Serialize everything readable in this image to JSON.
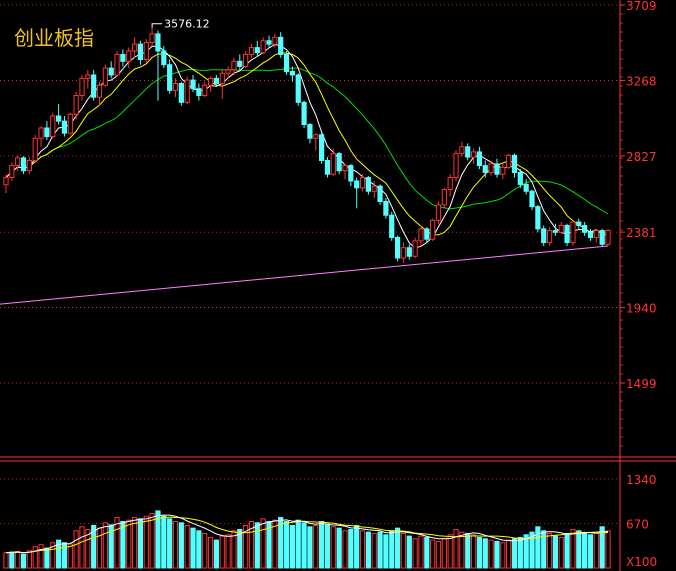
{
  "title": "创业板指",
  "chart_data": {
    "type": "candlestick",
    "title": "创业板指",
    "price_axis": {
      "ticks": [
        3709,
        3268,
        2827,
        2381,
        1940,
        1499
      ]
    },
    "volume_axis": {
      "ticks": [
        1340,
        670
      ],
      "unit": "X100"
    },
    "annotations": {
      "high_label": "3576.12",
      "high_value": 3576.12,
      "high_index": 25
    },
    "colors": {
      "up": "#ff3232",
      "down": "#54ffff",
      "ma5": "#ffffff",
      "ma10": "#ffff00",
      "ma20": "#00dd00",
      "ma250": "#ff80ff",
      "axis": "#ff3232",
      "label": "#ff3232"
    },
    "candles": [
      {
        "o": 2658,
        "h": 2720,
        "l": 2610,
        "c": 2700
      },
      {
        "o": 2700,
        "h": 2790,
        "l": 2680,
        "c": 2770
      },
      {
        "o": 2770,
        "h": 2830,
        "l": 2740,
        "c": 2815
      },
      {
        "o": 2815,
        "h": 2825,
        "l": 2720,
        "c": 2740
      },
      {
        "o": 2740,
        "h": 2820,
        "l": 2720,
        "c": 2800
      },
      {
        "o": 2800,
        "h": 2950,
        "l": 2790,
        "c": 2930
      },
      {
        "o": 2930,
        "h": 3000,
        "l": 2880,
        "c": 2990
      },
      {
        "o": 2990,
        "h": 3030,
        "l": 2920,
        "c": 2940
      },
      {
        "o": 2940,
        "h": 3080,
        "l": 2930,
        "c": 3060
      },
      {
        "o": 3060,
        "h": 3130,
        "l": 3010,
        "c": 3030
      },
      {
        "o": 3030,
        "h": 3060,
        "l": 2940,
        "c": 2960
      },
      {
        "o": 2960,
        "h": 3080,
        "l": 2950,
        "c": 3070
      },
      {
        "o": 3070,
        "h": 3200,
        "l": 3040,
        "c": 3180
      },
      {
        "o": 3180,
        "h": 3300,
        "l": 3150,
        "c": 3280
      },
      {
        "o": 3280,
        "h": 3330,
        "l": 3220,
        "c": 3300
      },
      {
        "o": 3300,
        "h": 3330,
        "l": 3150,
        "c": 3170
      },
      {
        "o": 3170,
        "h": 3260,
        "l": 3120,
        "c": 3240
      },
      {
        "o": 3240,
        "h": 3360,
        "l": 3230,
        "c": 3340
      },
      {
        "o": 3340,
        "h": 3380,
        "l": 3280,
        "c": 3300
      },
      {
        "o": 3300,
        "h": 3440,
        "l": 3290,
        "c": 3420
      },
      {
        "o": 3420,
        "h": 3450,
        "l": 3350,
        "c": 3380
      },
      {
        "o": 3380,
        "h": 3460,
        "l": 3340,
        "c": 3440
      },
      {
        "o": 3440,
        "h": 3520,
        "l": 3400,
        "c": 3480
      },
      {
        "o": 3480,
        "h": 3500,
        "l": 3360,
        "c": 3390
      },
      {
        "o": 3390,
        "h": 3510,
        "l": 3370,
        "c": 3490
      },
      {
        "o": 3490,
        "h": 3576,
        "l": 3470,
        "c": 3540
      },
      {
        "o": 3540,
        "h": 3560,
        "l": 3150,
        "c": 3440
      },
      {
        "o": 3440,
        "h": 3470,
        "l": 3340,
        "c": 3360
      },
      {
        "o": 3360,
        "h": 3390,
        "l": 3190,
        "c": 3210
      },
      {
        "o": 3210,
        "h": 3280,
        "l": 3170,
        "c": 3250
      },
      {
        "o": 3250,
        "h": 3260,
        "l": 3120,
        "c": 3140
      },
      {
        "o": 3140,
        "h": 3290,
        "l": 3130,
        "c": 3270
      },
      {
        "o": 3270,
        "h": 3300,
        "l": 3200,
        "c": 3220
      },
      {
        "o": 3220,
        "h": 3250,
        "l": 3150,
        "c": 3180
      },
      {
        "o": 3180,
        "h": 3260,
        "l": 3170,
        "c": 3240
      },
      {
        "o": 3240,
        "h": 3290,
        "l": 3200,
        "c": 3280
      },
      {
        "o": 3280,
        "h": 3300,
        "l": 3230,
        "c": 3250
      },
      {
        "o": 3250,
        "h": 3330,
        "l": 3160,
        "c": 3310
      },
      {
        "o": 3310,
        "h": 3350,
        "l": 3280,
        "c": 3330
      },
      {
        "o": 3330,
        "h": 3400,
        "l": 3300,
        "c": 3380
      },
      {
        "o": 3380,
        "h": 3420,
        "l": 3330,
        "c": 3350
      },
      {
        "o": 3350,
        "h": 3440,
        "l": 3340,
        "c": 3420
      },
      {
        "o": 3420,
        "h": 3480,
        "l": 3400,
        "c": 3460
      },
      {
        "o": 3460,
        "h": 3500,
        "l": 3410,
        "c": 3430
      },
      {
        "o": 3430,
        "h": 3520,
        "l": 3420,
        "c": 3500
      },
      {
        "o": 3500,
        "h": 3530,
        "l": 3460,
        "c": 3480
      },
      {
        "o": 3480,
        "h": 3540,
        "l": 3460,
        "c": 3520
      },
      {
        "o": 3520,
        "h": 3550,
        "l": 3400,
        "c": 3420
      },
      {
        "o": 3420,
        "h": 3440,
        "l": 3300,
        "c": 3320
      },
      {
        "o": 3320,
        "h": 3350,
        "l": 3260,
        "c": 3300
      },
      {
        "o": 3300,
        "h": 3310,
        "l": 3120,
        "c": 3140
      },
      {
        "o": 3140,
        "h": 3150,
        "l": 2990,
        "c": 3010
      },
      {
        "o": 3010,
        "h": 3020,
        "l": 2900,
        "c": 2930
      },
      {
        "o": 2930,
        "h": 2960,
        "l": 2860,
        "c": 2950
      },
      {
        "o": 2950,
        "h": 2960,
        "l": 2780,
        "c": 2800
      },
      {
        "o": 2800,
        "h": 2820,
        "l": 2700,
        "c": 2720
      },
      {
        "o": 2720,
        "h": 2870,
        "l": 2710,
        "c": 2840
      },
      {
        "o": 2840,
        "h": 2850,
        "l": 2720,
        "c": 2740
      },
      {
        "o": 2740,
        "h": 2780,
        "l": 2690,
        "c": 2770
      },
      {
        "o": 2770,
        "h": 2780,
        "l": 2650,
        "c": 2680
      },
      {
        "o": 2680,
        "h": 2700,
        "l": 2520,
        "c": 2640
      },
      {
        "o": 2640,
        "h": 2720,
        "l": 2620,
        "c": 2700
      },
      {
        "o": 2700,
        "h": 2710,
        "l": 2600,
        "c": 2620
      },
      {
        "o": 2620,
        "h": 2680,
        "l": 2580,
        "c": 2650
      },
      {
        "o": 2650,
        "h": 2660,
        "l": 2540,
        "c": 2560
      },
      {
        "o": 2560,
        "h": 2580,
        "l": 2460,
        "c": 2480
      },
      {
        "o": 2480,
        "h": 2500,
        "l": 2330,
        "c": 2350
      },
      {
        "o": 2350,
        "h": 2360,
        "l": 2210,
        "c": 2230
      },
      {
        "o": 2230,
        "h": 2320,
        "l": 2200,
        "c": 2290
      },
      {
        "o": 2290,
        "h": 2310,
        "l": 2220,
        "c": 2240
      },
      {
        "o": 2240,
        "h": 2350,
        "l": 2230,
        "c": 2330
      },
      {
        "o": 2330,
        "h": 2420,
        "l": 2300,
        "c": 2400
      },
      {
        "o": 2400,
        "h": 2410,
        "l": 2320,
        "c": 2340
      },
      {
        "o": 2340,
        "h": 2460,
        "l": 2330,
        "c": 2450
      },
      {
        "o": 2450,
        "h": 2560,
        "l": 2430,
        "c": 2540
      },
      {
        "o": 2540,
        "h": 2640,
        "l": 2520,
        "c": 2630
      },
      {
        "o": 2630,
        "h": 2720,
        "l": 2590,
        "c": 2700
      },
      {
        "o": 2700,
        "h": 2860,
        "l": 2680,
        "c": 2840
      },
      {
        "o": 2840,
        "h": 2910,
        "l": 2820,
        "c": 2880
      },
      {
        "o": 2880,
        "h": 2900,
        "l": 2800,
        "c": 2820
      },
      {
        "o": 2820,
        "h": 2870,
        "l": 2780,
        "c": 2850
      },
      {
        "o": 2850,
        "h": 2880,
        "l": 2750,
        "c": 2770
      },
      {
        "o": 2770,
        "h": 2800,
        "l": 2700,
        "c": 2730
      },
      {
        "o": 2730,
        "h": 2800,
        "l": 2710,
        "c": 2780
      },
      {
        "o": 2780,
        "h": 2810,
        "l": 2700,
        "c": 2720
      },
      {
        "o": 2720,
        "h": 2780,
        "l": 2690,
        "c": 2760
      },
      {
        "o": 2760,
        "h": 2840,
        "l": 2750,
        "c": 2830
      },
      {
        "o": 2830,
        "h": 2840,
        "l": 2700,
        "c": 2730
      },
      {
        "o": 2730,
        "h": 2750,
        "l": 2640,
        "c": 2660
      },
      {
        "o": 2660,
        "h": 2690,
        "l": 2600,
        "c": 2620
      },
      {
        "o": 2620,
        "h": 2630,
        "l": 2510,
        "c": 2530
      },
      {
        "o": 2530,
        "h": 2540,
        "l": 2380,
        "c": 2400
      },
      {
        "o": 2400,
        "h": 2420,
        "l": 2300,
        "c": 2320
      },
      {
        "o": 2320,
        "h": 2410,
        "l": 2300,
        "c": 2390
      },
      {
        "o": 2390,
        "h": 2430,
        "l": 2360,
        "c": 2380
      },
      {
        "o": 2380,
        "h": 2440,
        "l": 2370,
        "c": 2420
      },
      {
        "o": 2420,
        "h": 2430,
        "l": 2300,
        "c": 2320
      },
      {
        "o": 2320,
        "h": 2450,
        "l": 2300,
        "c": 2440
      },
      {
        "o": 2440,
        "h": 2460,
        "l": 2400,
        "c": 2420
      },
      {
        "o": 2420,
        "h": 2440,
        "l": 2360,
        "c": 2380
      },
      {
        "o": 2380,
        "h": 2400,
        "l": 2330,
        "c": 2350
      },
      {
        "o": 2350,
        "h": 2400,
        "l": 2320,
        "c": 2390
      },
      {
        "o": 2390,
        "h": 2400,
        "l": 2300,
        "c": 2310
      },
      {
        "o": 2310,
        "h": 2400,
        "l": 2300,
        "c": 2390
      }
    ],
    "ma250": {
      "start": 1960,
      "end": 2300
    },
    "volume": [
      {
        "v": 230,
        "up": true
      },
      {
        "v": 240,
        "up": false
      },
      {
        "v": 250,
        "up": true
      },
      {
        "v": 210,
        "up": false
      },
      {
        "v": 260,
        "up": true
      },
      {
        "v": 320,
        "up": true
      },
      {
        "v": 350,
        "up": true
      },
      {
        "v": 300,
        "up": false
      },
      {
        "v": 380,
        "up": true
      },
      {
        "v": 420,
        "up": false
      },
      {
        "v": 380,
        "up": false
      },
      {
        "v": 360,
        "up": true
      },
      {
        "v": 560,
        "up": true
      },
      {
        "v": 620,
        "up": true
      },
      {
        "v": 580,
        "up": true
      },
      {
        "v": 640,
        "up": false
      },
      {
        "v": 600,
        "up": true
      },
      {
        "v": 680,
        "up": true
      },
      {
        "v": 650,
        "up": false
      },
      {
        "v": 760,
        "up": true
      },
      {
        "v": 700,
        "up": false
      },
      {
        "v": 720,
        "up": true
      },
      {
        "v": 760,
        "up": true
      },
      {
        "v": 740,
        "up": false
      },
      {
        "v": 780,
        "up": true
      },
      {
        "v": 820,
        "up": true
      },
      {
        "v": 860,
        "up": false
      },
      {
        "v": 780,
        "up": false
      },
      {
        "v": 740,
        "up": false
      },
      {
        "v": 700,
        "up": true
      },
      {
        "v": 680,
        "up": false
      },
      {
        "v": 640,
        "up": true
      },
      {
        "v": 600,
        "up": false
      },
      {
        "v": 560,
        "up": false
      },
      {
        "v": 520,
        "up": true
      },
      {
        "v": 460,
        "up": true
      },
      {
        "v": 420,
        "up": false
      },
      {
        "v": 480,
        "up": true
      },
      {
        "v": 500,
        "up": true
      },
      {
        "v": 560,
        "up": true
      },
      {
        "v": 580,
        "up": false
      },
      {
        "v": 640,
        "up": true
      },
      {
        "v": 700,
        "up": true
      },
      {
        "v": 680,
        "up": false
      },
      {
        "v": 740,
        "up": true
      },
      {
        "v": 700,
        "up": false
      },
      {
        "v": 720,
        "up": true
      },
      {
        "v": 760,
        "up": false
      },
      {
        "v": 700,
        "up": false
      },
      {
        "v": 640,
        "up": false
      },
      {
        "v": 720,
        "up": false
      },
      {
        "v": 680,
        "up": false
      },
      {
        "v": 620,
        "up": false
      },
      {
        "v": 640,
        "up": true
      },
      {
        "v": 700,
        "up": false
      },
      {
        "v": 660,
        "up": false
      },
      {
        "v": 620,
        "up": true
      },
      {
        "v": 600,
        "up": false
      },
      {
        "v": 560,
        "up": true
      },
      {
        "v": 580,
        "up": false
      },
      {
        "v": 640,
        "up": false
      },
      {
        "v": 560,
        "up": true
      },
      {
        "v": 540,
        "up": false
      },
      {
        "v": 520,
        "up": true
      },
      {
        "v": 540,
        "up": false
      },
      {
        "v": 500,
        "up": false
      },
      {
        "v": 560,
        "up": false
      },
      {
        "v": 600,
        "up": false
      },
      {
        "v": 520,
        "up": true
      },
      {
        "v": 480,
        "up": false
      },
      {
        "v": 440,
        "up": true
      },
      {
        "v": 480,
        "up": true
      },
      {
        "v": 460,
        "up": false
      },
      {
        "v": 420,
        "up": true
      },
      {
        "v": 400,
        "up": true
      },
      {
        "v": 440,
        "up": true
      },
      {
        "v": 500,
        "up": true
      },
      {
        "v": 580,
        "up": true
      },
      {
        "v": 540,
        "up": true
      },
      {
        "v": 520,
        "up": false
      },
      {
        "v": 500,
        "up": true
      },
      {
        "v": 460,
        "up": false
      },
      {
        "v": 440,
        "up": false
      },
      {
        "v": 420,
        "up": true
      },
      {
        "v": 400,
        "up": false
      },
      {
        "v": 380,
        "up": true
      },
      {
        "v": 420,
        "up": true
      },
      {
        "v": 440,
        "up": false
      },
      {
        "v": 460,
        "up": false
      },
      {
        "v": 500,
        "up": false
      },
      {
        "v": 540,
        "up": false
      },
      {
        "v": 620,
        "up": false
      },
      {
        "v": 560,
        "up": false
      },
      {
        "v": 520,
        "up": true
      },
      {
        "v": 480,
        "up": false
      },
      {
        "v": 460,
        "up": true
      },
      {
        "v": 520,
        "up": false
      },
      {
        "v": 580,
        "up": true
      },
      {
        "v": 560,
        "up": false
      },
      {
        "v": 520,
        "up": false
      },
      {
        "v": 500,
        "up": false
      },
      {
        "v": 540,
        "up": true
      },
      {
        "v": 620,
        "up": false
      },
      {
        "v": 560,
        "up": true
      }
    ],
    "volume_ma": {
      "slow": [
        300,
        700,
        640,
        480,
        420
      ]
    }
  }
}
